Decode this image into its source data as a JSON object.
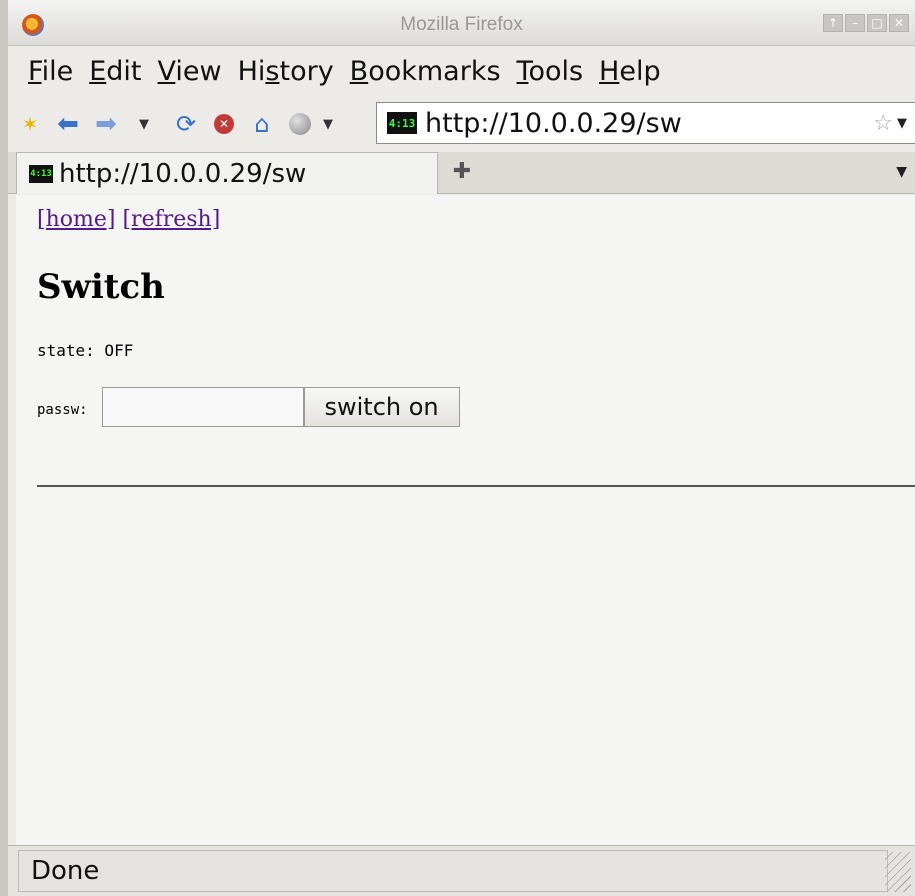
{
  "window": {
    "title": "Mozilla Firefox"
  },
  "menubar": {
    "items": [
      {
        "underline": "F",
        "rest": "ile"
      },
      {
        "underline": "E",
        "rest": "dit"
      },
      {
        "underline": "V",
        "rest": "iew"
      },
      {
        "pre": "Hi",
        "underline": "s",
        "rest": "tory"
      },
      {
        "underline": "B",
        "rest": "ookmarks"
      },
      {
        "underline": "T",
        "rest": "ools"
      },
      {
        "underline": "H",
        "rest": "elp"
      }
    ]
  },
  "toolbar": {
    "url": "http://10.0.0.29/sw",
    "favicon_text": "4:13"
  },
  "tabs": [
    {
      "label": "http://10.0.0.29/sw"
    }
  ],
  "content": {
    "links": {
      "home": "[home]",
      "refresh": "[refresh]"
    },
    "heading": "Switch",
    "state_text": "state: OFF",
    "passw_label": "passw:",
    "passw_value": "",
    "switch_button": "switch on"
  },
  "status": {
    "text": "Done"
  }
}
